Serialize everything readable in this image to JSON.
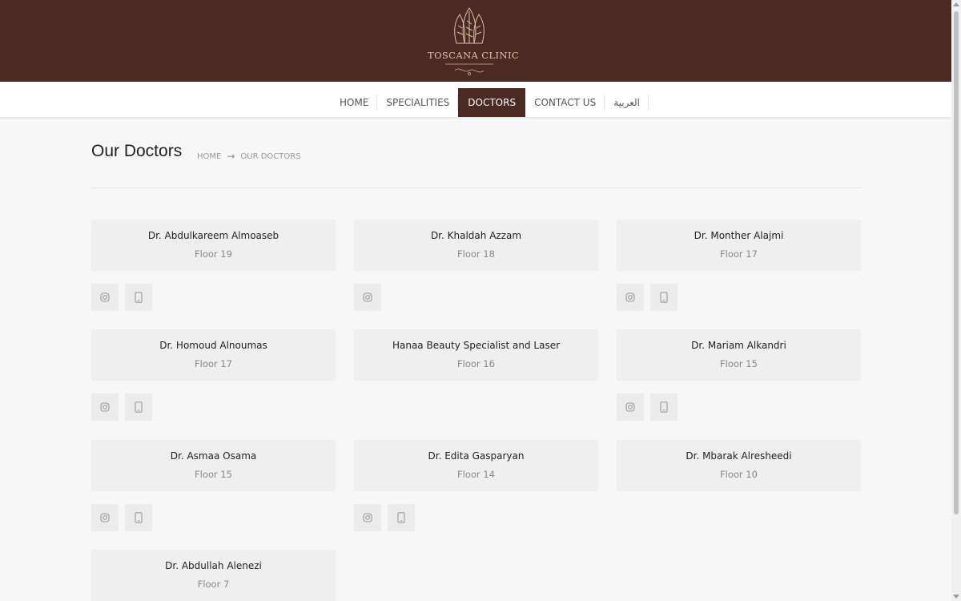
{
  "brand": {
    "name": "TOSCANA CLINIC"
  },
  "nav": {
    "items": [
      {
        "label": "HOME",
        "active": false
      },
      {
        "label": "SPECIALITIES",
        "active": false
      },
      {
        "label": "DOCTORS",
        "active": true
      },
      {
        "label": "CONTACT US",
        "active": false
      },
      {
        "label": "العربية",
        "active": false
      }
    ]
  },
  "page": {
    "title": "Our Doctors",
    "breadcrumb": [
      "HOME",
      "OUR DOCTORS"
    ],
    "breadcrumb_arrow": "→"
  },
  "doctors": [
    {
      "name": "Dr. Abdulkareem Almoaseb",
      "floor": "Floor 19",
      "icons": [
        "instagram-icon",
        "phone-icon"
      ]
    },
    {
      "name": "Dr. Khaldah Azzam",
      "floor": "Floor 18",
      "icons": [
        "instagram-icon"
      ]
    },
    {
      "name": "Dr. Monther Alajmi",
      "floor": "Floor 17",
      "icons": [
        "instagram-icon",
        "phone-icon"
      ]
    },
    {
      "name": "Dr. Homoud Alnoumas",
      "floor": "Floor 17",
      "icons": [
        "instagram-icon",
        "phone-icon"
      ]
    },
    {
      "name": "Hanaa Beauty Specialist and Laser",
      "floor": "Floor 16",
      "icons": []
    },
    {
      "name": "Dr. Mariam Alkandri",
      "floor": "Floor 15",
      "icons": [
        "instagram-icon",
        "phone-icon"
      ]
    },
    {
      "name": "Dr. Asmaa Osama",
      "floor": "Floor 15",
      "icons": [
        "instagram-icon",
        "phone-icon"
      ]
    },
    {
      "name": "Dr. Edita Gasparyan",
      "floor": "Floor 14",
      "icons": [
        "instagram-icon",
        "phone-icon"
      ]
    },
    {
      "name": "Dr. Mbarak Alresheedi",
      "floor": "Floor 10",
      "icons": []
    },
    {
      "name": "Dr. Abdullah Alenezi",
      "floor": "Floor 7",
      "icons": []
    }
  ],
  "colors": {
    "header": "#4a2a23",
    "accent": "#4a2a23",
    "card": "#efefef",
    "page": "#f7f7f7"
  }
}
